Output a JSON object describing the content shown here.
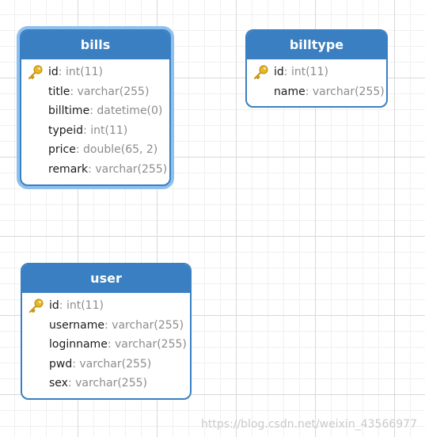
{
  "tables": {
    "bills": {
      "name": "bills",
      "fields": [
        {
          "name": "id",
          "type": ": int(11)",
          "pk": true
        },
        {
          "name": "title",
          "type": ": varchar(255)",
          "pk": false
        },
        {
          "name": "billtime",
          "type": ": datetime(0)",
          "pk": false
        },
        {
          "name": "typeid",
          "type": ": int(11)",
          "pk": false
        },
        {
          "name": "price",
          "type": ": double(65, 2)",
          "pk": false
        },
        {
          "name": "remark",
          "type": ": varchar(255)",
          "pk": false
        }
      ]
    },
    "billtype": {
      "name": "billtype",
      "fields": [
        {
          "name": "id",
          "type": ": int(11)",
          "pk": true
        },
        {
          "name": "name",
          "type": ": varchar(255)",
          "pk": false
        }
      ]
    },
    "user": {
      "name": "user",
      "fields": [
        {
          "name": "id",
          "type": ": int(11)",
          "pk": true
        },
        {
          "name": "username",
          "type": ": varchar(255)",
          "pk": false
        },
        {
          "name": "loginname",
          "type": ": varchar(255)",
          "pk": false
        },
        {
          "name": "pwd",
          "type": ": varchar(255)",
          "pk": false
        },
        {
          "name": "sex",
          "type": ": varchar(255)",
          "pk": false
        }
      ]
    }
  },
  "watermark": "https://blog.csdn.net/weixin_43566977",
  "colors": {
    "header": "#3a7fc1",
    "selection": "#8ec0ef",
    "key": "#e8b923"
  }
}
